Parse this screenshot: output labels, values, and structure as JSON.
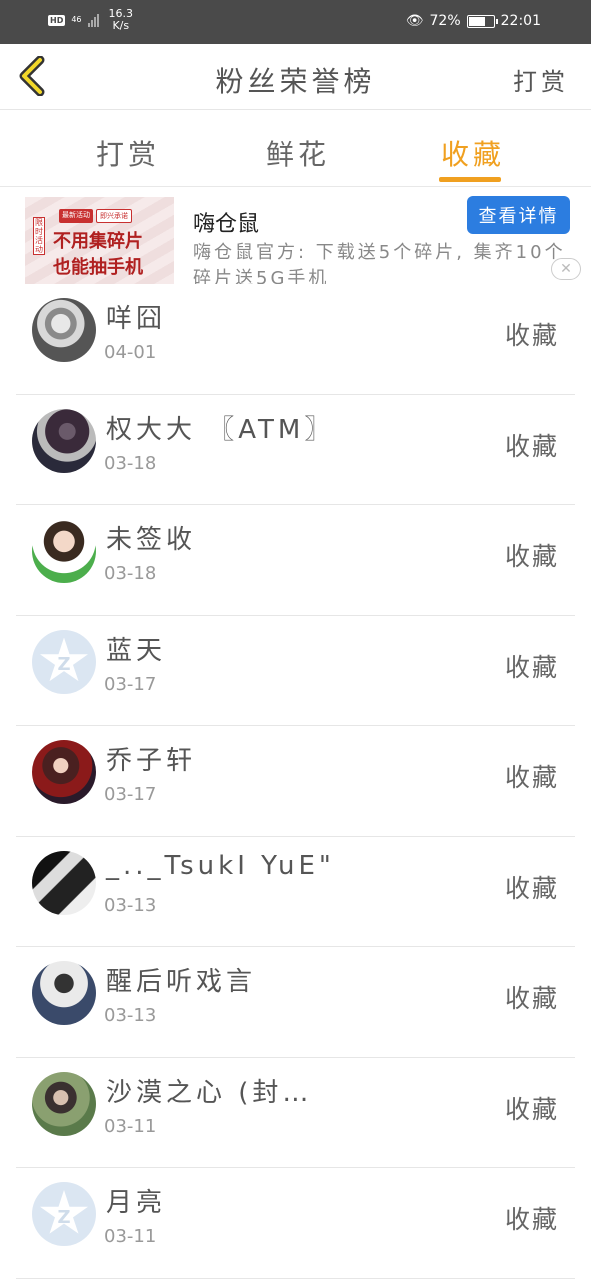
{
  "status_bar": {
    "hd": "HD",
    "network": "46",
    "speed_value": "16.3",
    "speed_unit": "K/s",
    "battery": "72%",
    "battery_level": 0.72,
    "time": "22:01"
  },
  "header": {
    "title": "粉丝荣誉榜",
    "action": "打赏"
  },
  "tabs": [
    {
      "label": "打赏",
      "active": false
    },
    {
      "label": "鲜花",
      "active": false
    },
    {
      "label": "收藏",
      "active": true
    }
  ],
  "ad": {
    "image_tag": "限时活动",
    "image_badge_1": "最新活动",
    "image_badge_2": "即兴承诺",
    "image_line1": "不用集碎片",
    "image_line2": "也能抽手机",
    "name": "嗨仓鼠",
    "description": "嗨仓鼠官方: 下载送5个碎片, 集齐10个碎片送5G手机",
    "button": "查看详情",
    "close": "✕"
  },
  "list": [
    {
      "name": "咩囧",
      "date": "04-01",
      "action": "收藏",
      "avatar": "photo-1"
    },
    {
      "name": "权大大 〖ATM〗",
      "date": "03-18",
      "action": "收藏",
      "avatar": "photo-2"
    },
    {
      "name": "未签收",
      "date": "03-18",
      "action": "收藏",
      "avatar": "photo-3"
    },
    {
      "name": "蓝天",
      "date": "03-17",
      "action": "收藏",
      "avatar": "default"
    },
    {
      "name": "乔子轩",
      "date": "03-17",
      "action": "收藏",
      "avatar": "photo-4"
    },
    {
      "name": "_.._TsukI YuE\"",
      "date": "03-13",
      "action": "收藏",
      "avatar": "photo-5"
    },
    {
      "name": "醒后听戏言",
      "date": "03-13",
      "action": "收藏",
      "avatar": "photo-6"
    },
    {
      "name": "沙漠之心 (封…",
      "date": "03-11",
      "action": "收藏",
      "avatar": "photo-7"
    },
    {
      "name": "月亮",
      "date": "03-11",
      "action": "收藏",
      "avatar": "default"
    }
  ],
  "colors": {
    "accent": "#f0a020",
    "status_bar": "#4a4a4a",
    "ad_button": "#2c7de0"
  }
}
